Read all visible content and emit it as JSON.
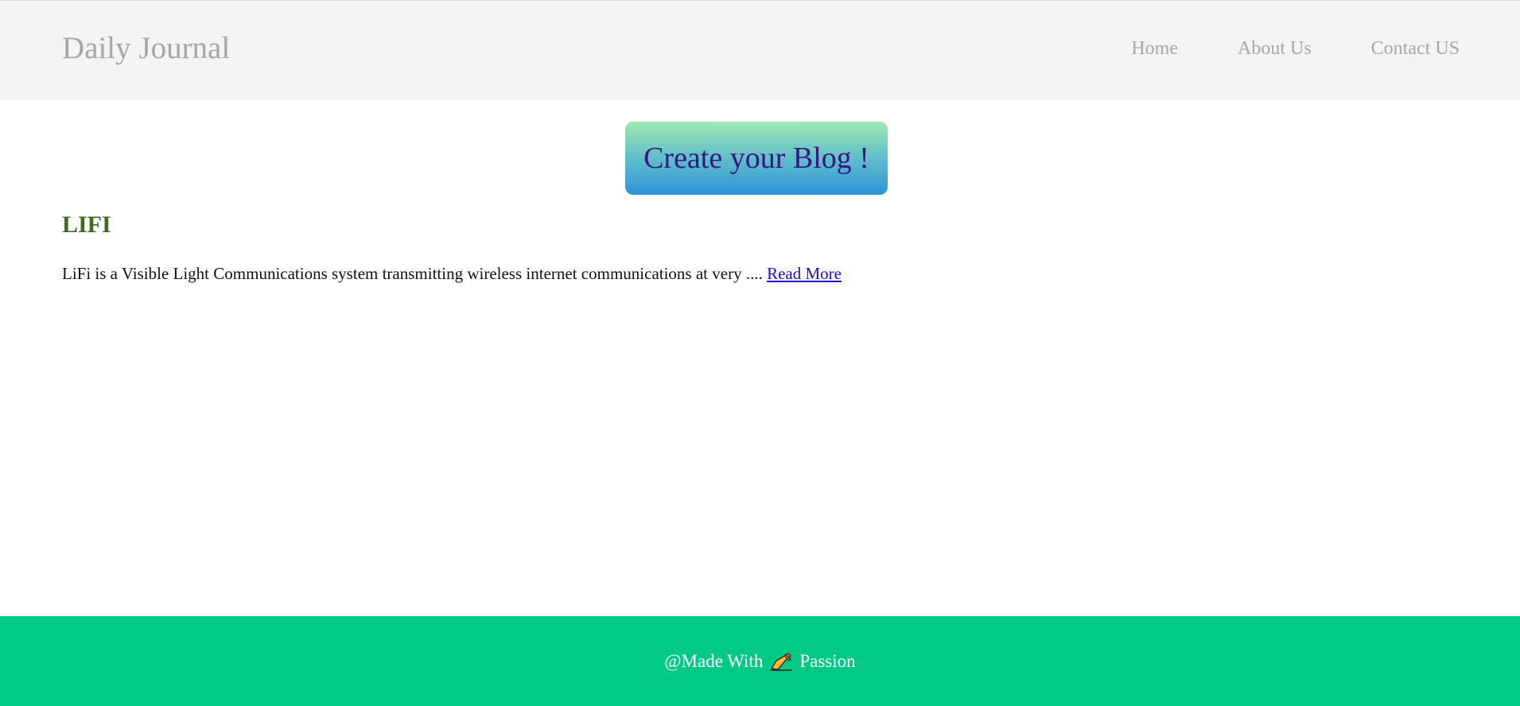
{
  "header": {
    "brand": "Daily Journal",
    "nav": [
      {
        "label": "Home"
      },
      {
        "label": "About Us"
      },
      {
        "label": "Contact US"
      }
    ]
  },
  "main": {
    "create_button_label": "Create your Blog !",
    "posts": [
      {
        "title": "LIFI",
        "excerpt": "LiFi is a Visible Light Communications system transmitting wireless internet communications at very ....",
        "read_more_label": "Read More"
      }
    ]
  },
  "footer": {
    "prefix": "@Made With",
    "icon": "writing-hand-icon",
    "suffix": "Passion"
  },
  "colors": {
    "header_bg": "#f4f4f4",
    "nav_text": "#a7a7a7",
    "button_text": "#3a1780",
    "post_title": "#3e6b1f",
    "link": "#1a0dcc",
    "footer_bg": "#03c986"
  }
}
